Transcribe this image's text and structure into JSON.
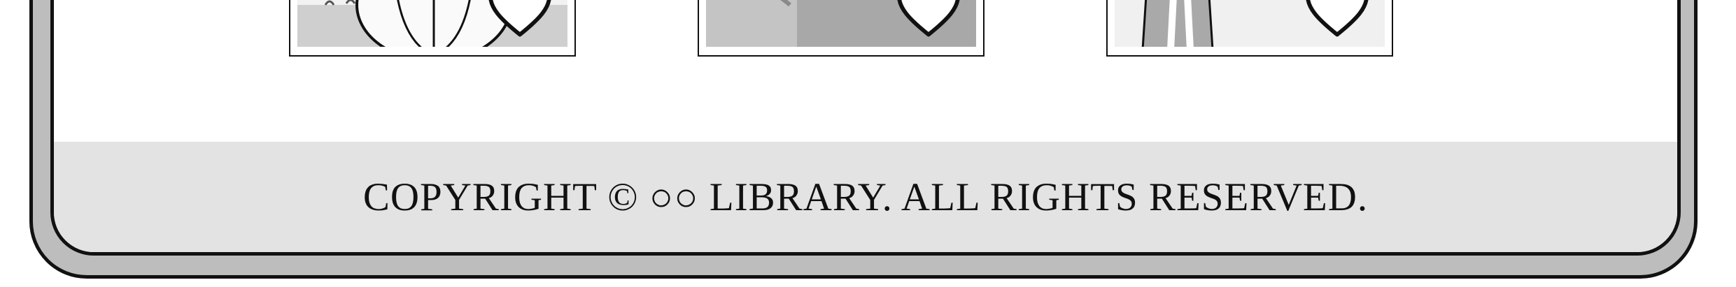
{
  "cards": [
    {
      "id": "card-1",
      "favorite_icon": "heart-outline-icon"
    },
    {
      "id": "card-2",
      "favorite_icon": "heart-outline-icon"
    },
    {
      "id": "card-3",
      "favorite_icon": "heart-outline-icon"
    }
  ],
  "footer": {
    "copyright_text": "COPYRIGHT © ○○ LIBRARY. ALL RIGHTS RESERVED."
  },
  "colors": {
    "frame": "#bdbdbd",
    "footer_band": "#e3e3e3",
    "outline": "#111111"
  }
}
